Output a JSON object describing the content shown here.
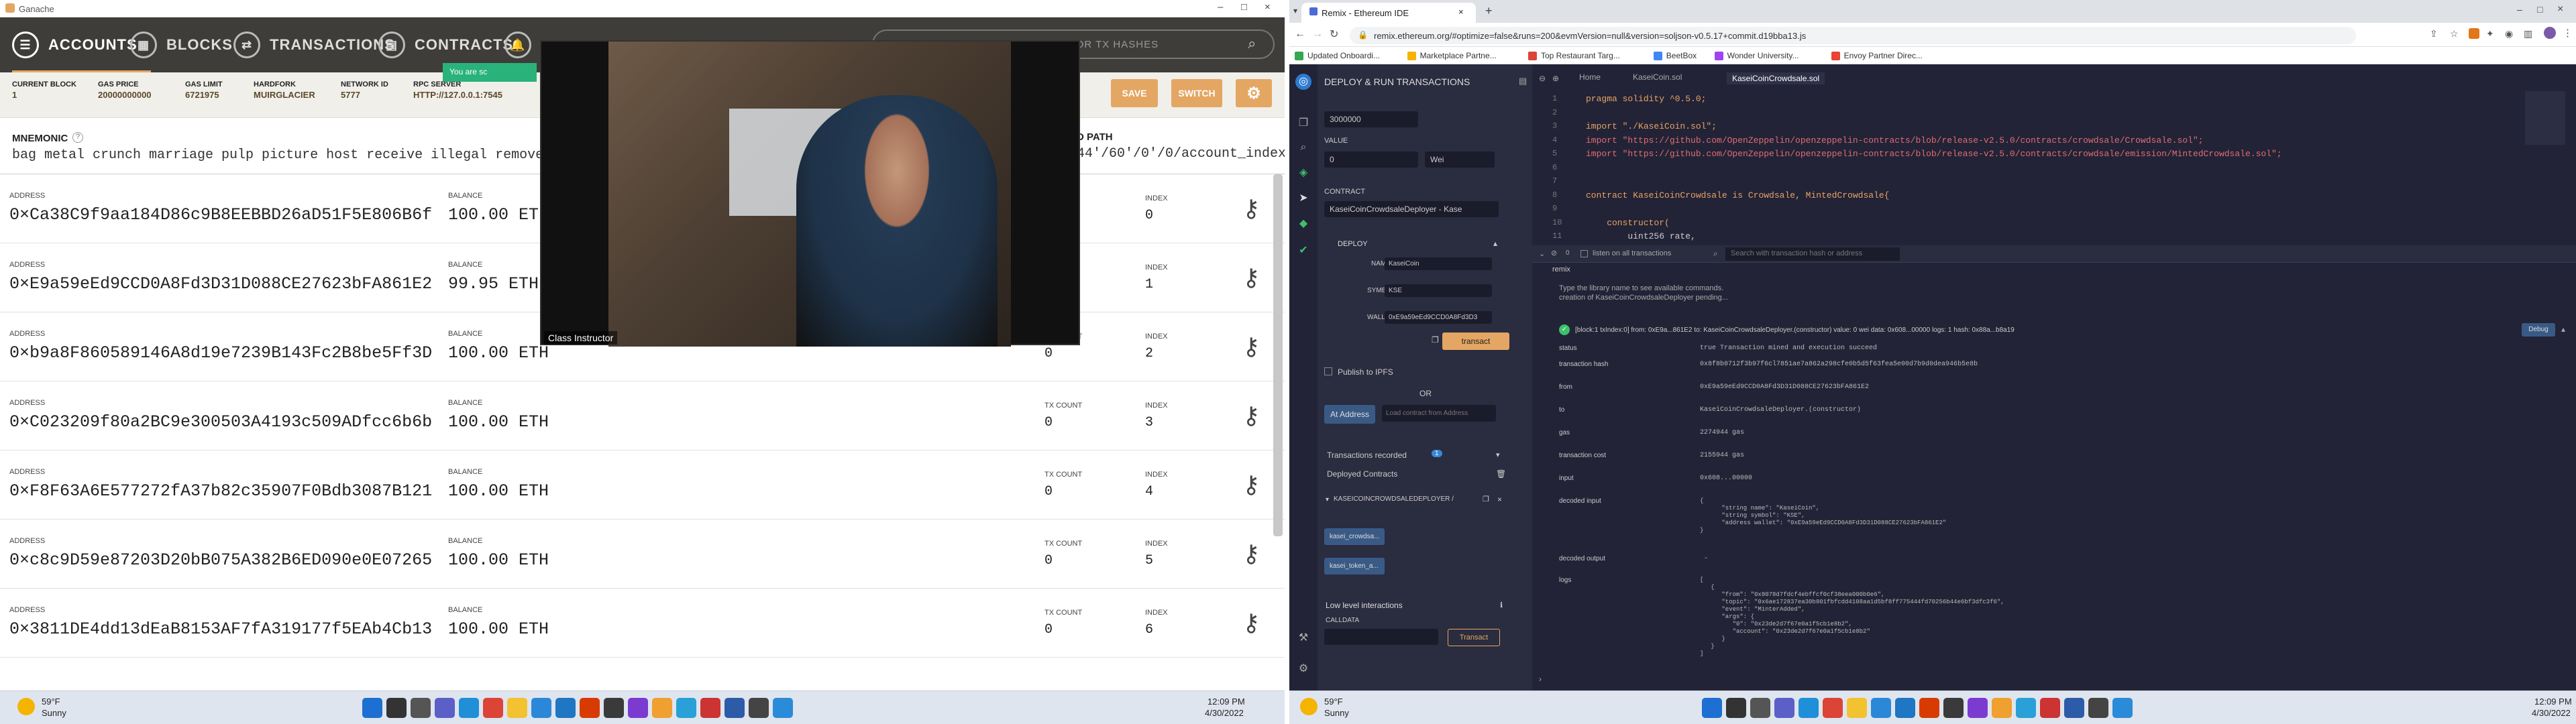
{
  "ganache": {
    "window_title": "Ganache",
    "nav": {
      "accounts": "ACCOUNTS",
      "blocks": "BLOCKS",
      "transactions": "TRANSACTIONS",
      "contracts": "CONTRACTS"
    },
    "search_placeholder": "SEARCH FOR BLOCK NUMBERS OR TX HASHES",
    "status": {
      "current_block_label": "CURRENT BLOCK",
      "current_block": "1",
      "gas_price_label": "GAS PRICE",
      "gas_price": "20000000000",
      "gas_limit_label": "GAS LIMIT",
      "gas_limit": "6721975",
      "hardfork_label": "HARDFORK",
      "hardfork": "MUIRGLACIER",
      "network_id_label": "NETWORK ID",
      "network_id": "5777",
      "rpc_server_label": "RPC SERVER",
      "rpc_server": "HTTP://127.0.0.1:7545"
    },
    "banner": "You are sc",
    "save_label": "SAVE",
    "switch_label": "SWITCH",
    "mnemonic_label": "MNEMONIC",
    "mnemonic": "bag metal crunch marriage pulp picture host receive illegal remove essenc",
    "hd_path_label": "D PATH",
    "hd_path": "44'/60'/0'/0/account_index",
    "address_label": "ADDRESS",
    "balance_label": "BALANCE",
    "tx_count_label": "TX COUNT",
    "index_label": "INDEX",
    "accounts": [
      {
        "address": "0×Ca38C9f9aa184D86c9B8EEBBD26aD51F5E806B6f",
        "balance": "100.00 ETH",
        "tx_count": "",
        "index": "0"
      },
      {
        "address": "0×E9a59eEd9CCD0A8Fd3D31D088CE27623bFA861E2",
        "balance": "99.95 ETH",
        "tx_count": "",
        "index": "1"
      },
      {
        "address": "0×b9a8F860589146A8d19e7239B143Fc2B8be5Ff3D",
        "balance": "100.00 ETH",
        "tx_count": "0",
        "index": "2"
      },
      {
        "address": "0×C023209f80a2BC9e300503A4193c509ADfcc6b6b",
        "balance": "100.00 ETH",
        "tx_count": "0",
        "index": "3"
      },
      {
        "address": "0×F8F63A6E577272fA37b82c35907F0Bdb3087B121",
        "balance": "100.00 ETH",
        "tx_count": "0",
        "index": "4"
      },
      {
        "address": "0×c8c9D59e87203D20bB075A382B6ED090e0E07265",
        "balance": "100.00 ETH",
        "tx_count": "0",
        "index": "5"
      },
      {
        "address": "0×3811DE4dd13dEaB8153AF7fA319177f5EAb4Cb13",
        "balance": "100.00 ETH",
        "tx_count": "0",
        "index": "6"
      }
    ],
    "video_label": "Class Instructor"
  },
  "taskbar_left": {
    "weather_temp": "59°F",
    "weather_desc": "Sunny",
    "time": "12:09 PM",
    "date": "4/30/2022"
  },
  "taskbar_right": {
    "weather_temp": "59°F",
    "weather_desc": "Sunny",
    "time": "12:09 PM",
    "date": "4/30/2022"
  },
  "chrome": {
    "tab_title": "Remix - Ethereum IDE",
    "url": "remix.ethereum.org/#optimize=false&runs=200&evmVersion=null&version=soljson-v0.5.17+commit.d19bba13.js",
    "bookmarks": [
      "Updated Onboardi...",
      "Marketplace Partne...",
      "Top Restaurant Targ...",
      "BeetBox",
      "Wonder University...",
      "Envoy Partner Direc..."
    ]
  },
  "remix": {
    "panel_title": "DEPLOY & RUN TRANSACTIONS",
    "gas_limit_value": "3000000",
    "value_label": "VALUE",
    "value": "0",
    "value_unit": "Wei",
    "contract_label": "CONTRACT",
    "contract_selected": "KaseiCoinCrowdsaleDeployer - Kase",
    "deploy_label": "DEPLOY",
    "name_label": "NAME",
    "name_value": "KaseiCoin",
    "symbol_label": "SYMBOL",
    "symbol_value": "KSE",
    "wallet_label": "WALLET",
    "wallet_value": "0xE9a59eEd9CCD0A8Fd3D3",
    "transact_label": "transact",
    "publish_ipfs": "Publish to IPFS",
    "or_label": "OR",
    "at_address": "At Address",
    "load_from_address": "Load contract from Address",
    "tx_recorded": "Transactions recorded",
    "tx_recorded_count": "1",
    "deployed_contracts": "Deployed Contracts",
    "deployed_instance": "KASEICOINCROWDSALEDEPLOYER /",
    "instance_btn_1": "kasei_crowdsa...",
    "instance_btn_2": "kasei_token_a...",
    "low_level": "Low level interactions",
    "calldata_label": "CALLDATA",
    "calldata_transact": "Transact",
    "editor_tabs": [
      "Home",
      "KaseiCoin.sol",
      "KaseiCoinCrowdsale.sol"
    ],
    "code_lines": [
      {
        "n": "1",
        "t": "pragma solidity ^0.5.0;"
      },
      {
        "n": "2",
        "t": ""
      },
      {
        "n": "3",
        "t": "import \"./KaseiCoin.sol\";"
      },
      {
        "n": "4",
        "t": "import \"https://github.com/OpenZeppelin/openzeppelin-contracts/blob/release-v2.5.0/contracts/crowdsale/Crowdsale.sol\";"
      },
      {
        "n": "5",
        "t": "import \"https://github.com/OpenZeppelin/openzeppelin-contracts/blob/release-v2.5.0/contracts/crowdsale/emission/MintedCrowdsale.sol\";"
      },
      {
        "n": "6",
        "t": ""
      },
      {
        "n": "7",
        "t": ""
      },
      {
        "n": "8",
        "t": "contract KaseiCoinCrowdsale is Crowdsale, MintedCrowdsale{"
      },
      {
        "n": "9",
        "t": ""
      },
      {
        "n": "10",
        "t": "    constructor("
      },
      {
        "n": "11",
        "t": "        uint256 rate,"
      }
    ],
    "term_listen": "listen on all transactions",
    "term_search_placeholder": "Search with transaction hash or address",
    "term_remix": "remix",
    "term_help_1": "Type the library name to see available commands.",
    "term_help_2": "creation of KaseiCoinCrowdsaleDeployer pending...",
    "term_tx_summary": "[block:1 txIndex:0]  from: 0xE9a...861E2 to: KaseiCoinCrowdsaleDeployer.(constructor) value: 0 wei data: 0x608...00000 logs: 1 hash: 0x88a...b8a19",
    "debug_label": "Debug",
    "tx_fields": [
      {
        "k": "status",
        "v": "true Transaction mined and execution succeed"
      },
      {
        "k": "transaction hash",
        "v": "0x8f8b0712f3b97f6cl7851ae7a862a298cfe0b5d5f63fea5e00d7b9d0dea946b5e8b"
      },
      {
        "k": "from",
        "v": "0xE9a59eEd9CCD0A8Fd3D31D088CE27623bFA861E2"
      },
      {
        "k": "to",
        "v": "KaseiCoinCrowdsaleDeployer.(constructor)"
      },
      {
        "k": "gas",
        "v": "2274944 gas"
      },
      {
        "k": "transaction cost",
        "v": "2155944 gas"
      },
      {
        "k": "input",
        "v": "0x608...00000"
      },
      {
        "k": "decoded input",
        "v": "{\n      \"string name\": \"KaseiCoin\",\n      \"string symbol\": \"KSE\",\n      \"address wallet\": \"0xE9a59eEd9CCD0A8Fd3D31D088CE27623bFA861E2\"\n}"
      },
      {
        "k": "decoded output",
        "v": " - "
      },
      {
        "k": "logs",
        "v": "[\n   {\n      \"from\": \"0x8078d7fdcf4ebffcf0cf38eea000b0e6\",\n      \"topic\": \"0x6ae172837ea30b801fbfcdd4108aa1d5bf8ff775444fd70256b44e6bf3dfc3f6\",\n      \"event\": \"MinterAdded\",\n      \"args\": {\n         \"0\": \"0x23de2d7f67e0a1f5cb1e8b2\",\n         \"account\": \"0x23de2d7f67e0a1f5cb1e8b2\"\n      }\n   }\n]"
      }
    ]
  }
}
